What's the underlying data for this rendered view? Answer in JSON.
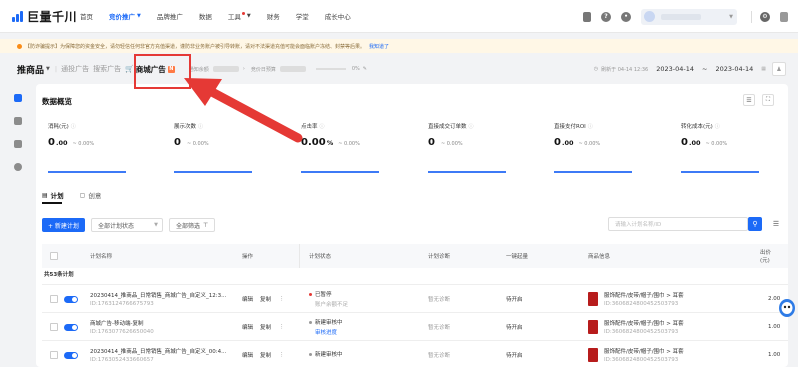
{
  "topbar": {
    "brand": "巨量千川",
    "nav": [
      {
        "label": "首页",
        "active": false
      },
      {
        "label": "竞价推广",
        "active": true,
        "caret": true
      },
      {
        "label": "品牌推广",
        "active": false
      },
      {
        "label": "数据",
        "active": false
      },
      {
        "label": "工具",
        "active": false,
        "caret": true,
        "dot": true
      },
      {
        "label": "财务",
        "active": false
      },
      {
        "label": "学堂",
        "active": false
      },
      {
        "label": "成长中心",
        "active": false
      }
    ]
  },
  "notice": {
    "text": "【防诈骗提示】为保障您的资金安全，请勿轻信任何非官方充值渠道，谨防非业务账户被引导转账，请对不法渠道充值可能会面临账户冻结、封禁等后果。",
    "link": "我知道了"
  },
  "subheader": {
    "title": "推商品",
    "tabs": [
      "通投广告",
      "搜索广告",
      "商城广告"
    ],
    "meta_label": "通知余额",
    "budget_label": "竞价日预算",
    "percent": "0%",
    "updated": "刷新于 04-14 12:36",
    "date_start": "2023-04-14",
    "date_sep": "~",
    "date_end": "2023-04-14"
  },
  "overview": {
    "title": "数据概览",
    "metrics": [
      {
        "label": "消耗(元)",
        "value": "0",
        "decimals": ".00",
        "trend": "~ 0.00%"
      },
      {
        "label": "展示次数",
        "value": "0",
        "decimals": "",
        "trend": "~ 0.00%"
      },
      {
        "label": "点击率",
        "value": "0.00",
        "decimals": " %",
        "trend": "~ 0.00%"
      },
      {
        "label": "直接成交订单数",
        "value": "0",
        "decimals": "",
        "trend": "~ 0.00%"
      },
      {
        "label": "直接支付ROI",
        "value": "0",
        "decimals": ".00",
        "trend": "~ 0.00%"
      },
      {
        "label": "转化成本(元)",
        "value": "0",
        "decimals": ".00",
        "trend": "~ 0.00%"
      }
    ]
  },
  "tabs": [
    "计划",
    "创意"
  ],
  "toolbar": {
    "new_button": "+ 新建计划",
    "status_select": "全部计划状态",
    "filter": "全部筛选",
    "search_placeholder": "请输入计划名称/ID"
  },
  "table": {
    "headers": {
      "name": "计划名称",
      "op": "操作",
      "status": "计划状态",
      "diag": "计划诊断",
      "bid": "一键起量",
      "product": "商品信息",
      "spend_top": "出价",
      "spend_bottom": "(元)"
    },
    "total": "共53条计划",
    "rows": [
      {
        "name": "20230414_推商品_日常销售_商城广告_自定义_12:3...",
        "id": "ID:1763124766675793",
        "edit": "编辑",
        "copy": "复制",
        "more": "⋮",
        "status": "已暂停",
        "status_color": "red",
        "status_desc": "账户余额不足",
        "diag": "暂无诊断",
        "bid": "待开启",
        "category": "服饰配件/皮带/帽子/围巾 > 耳套",
        "product_id": "ID:3606824800452503793",
        "price": "2.00"
      },
      {
        "name": "商城广告-移动端-复制",
        "id": "ID:1763077626650040",
        "edit": "编辑",
        "copy": "复制",
        "more": "⋮",
        "status": "新建审核中",
        "status_color": "grey",
        "status_desc": "审核进度",
        "diag": "暂无诊断",
        "bid": "待开启",
        "category": "服饰配件/皮带/帽子/围巾 > 耳套",
        "product_id": "ID:3606824800452503793",
        "price": "1.00"
      },
      {
        "name": "20230414_推商品_日常销售_商城广告_自定义_00:4...",
        "id": "ID:1763052433660657",
        "edit": "编辑",
        "copy": "复制",
        "more": "⋮",
        "status": "新建审核中",
        "status_color": "grey",
        "status_desc": "",
        "diag": "暂无诊断",
        "bid": "待开启",
        "category": "服饰配件/皮带/帽子/围巾 > 耳套",
        "product_id": "ID:3606824800452503793",
        "price": "1.00"
      }
    ]
  },
  "colors": {
    "brand_blue": "#1c6af7",
    "annotation_red": "#e53935",
    "new_badge": "#ff7a45"
  }
}
